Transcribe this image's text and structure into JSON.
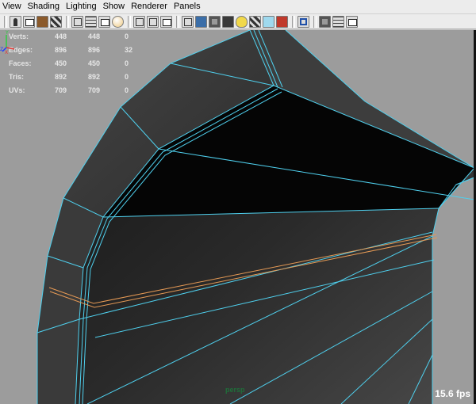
{
  "menu": {
    "items": [
      "View",
      "Shading",
      "Lighting",
      "Show",
      "Renderer",
      "Panels"
    ]
  },
  "toolbar": {
    "icons": [
      "camera-select-icon",
      "camera-attributes-icon",
      "bookmark-icon",
      "image-plane-icon",
      "2d-pan-zoom-icon",
      "grease-pencil-icon",
      "grid-icon",
      "film-gate-icon",
      "resolution-gate-icon",
      "gate-mask-icon",
      "wireframe-icon",
      "smooth-shade-icon",
      "wireframe-on-shaded-icon",
      "textured-icon",
      "use-all-lights-icon",
      "shadows-icon",
      "screen-space-ao-icon",
      "motion-blur-icon",
      "isolate-select-icon",
      "xray-icon",
      "xray-joints-icon",
      "xray-components-icon"
    ]
  },
  "hud": {
    "rows": [
      {
        "label": "Verts:",
        "v1": "448",
        "v2": "448",
        "v3": "0"
      },
      {
        "label": "Edges:",
        "v1": "896",
        "v2": "896",
        "v3": "32"
      },
      {
        "label": "Faces:",
        "v1": "450",
        "v2": "450",
        "v3": "0"
      },
      {
        "label": "Tris:",
        "v1": "892",
        "v2": "892",
        "v3": "0"
      },
      {
        "label": "UVs:",
        "v1": "709",
        "v2": "709",
        "v3": "0"
      }
    ]
  },
  "viewport": {
    "camera": "persp",
    "fps": "15.6 fps",
    "axis_labels": {
      "y": "Y",
      "z": "Z",
      "x": "X"
    },
    "colors": {
      "background": "#9c9c9c",
      "mesh_face": "#3b3b3b",
      "wire": "#4fd0ee",
      "selected_edge": "#e69a55",
      "hud_text": "#e6e6e6",
      "camera_label": "#1f6f3a"
    }
  }
}
